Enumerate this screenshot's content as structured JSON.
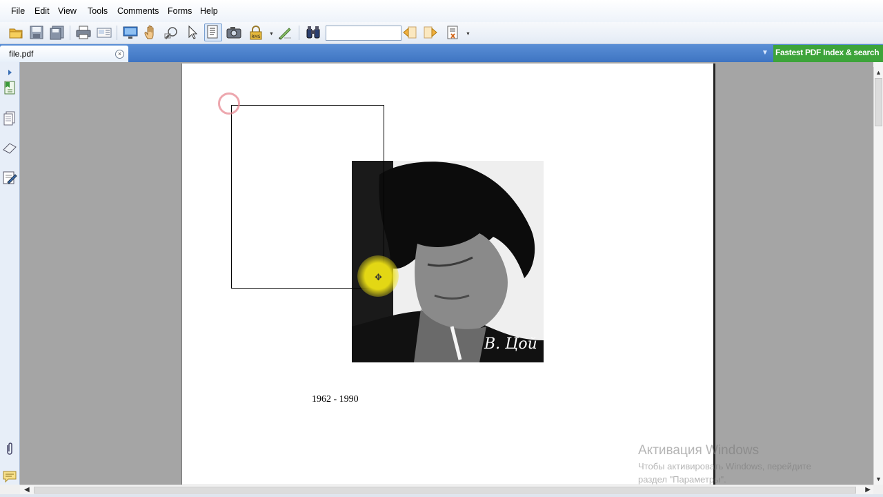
{
  "menu": {
    "items": [
      {
        "label": "File"
      },
      {
        "label": "Edit"
      },
      {
        "label": "View"
      },
      {
        "label": "Tools"
      },
      {
        "label": "Comments"
      },
      {
        "label": "Forms"
      },
      {
        "label": "Help"
      }
    ]
  },
  "toolbar": {
    "icons": [
      "open-folder-icon",
      "save-icon",
      "save-as-icon",
      "print-icon",
      "email-icon",
      "fullscreen-icon",
      "hand-tool-icon",
      "zoom-tool-icon",
      "select-arrow-icon",
      "text-select-icon",
      "snapshot-icon",
      "rms-lock-icon",
      "sign-pen-icon",
      "find-binoculars-icon",
      "find-prev-icon",
      "find-next-icon",
      "highlight-options-icon"
    ],
    "search": {
      "value": "",
      "placeholder": ""
    }
  },
  "tabs": {
    "active": {
      "label": "file.pdf"
    },
    "close_glyph": "×",
    "dropdown_glyph": "▼",
    "promo": "Fastest PDF Index & search"
  },
  "left_panel": {
    "icons": [
      "expand-panel-icon",
      "bookmarks-icon",
      "pages-icon",
      "layers-icon",
      "signatures-icon",
      "attachments-icon",
      "comments-icon"
    ]
  },
  "document": {
    "caption": "1962 - 1990",
    "photo_signature": "В. Цой"
  },
  "scroll": {
    "up": "▲",
    "down": "▼",
    "left": "◀",
    "right": "▶"
  },
  "watermark": {
    "title": "Активация Windows",
    "line1": "Чтобы активировать Windows, перейдите",
    "line2": "раздел \"Параметры\"."
  },
  "colors": {
    "tabbar": "#4a82cc",
    "promo_bg": "#3da43a",
    "doc_bg": "#a5a5a5",
    "cursor_highlight": "#eee114"
  }
}
